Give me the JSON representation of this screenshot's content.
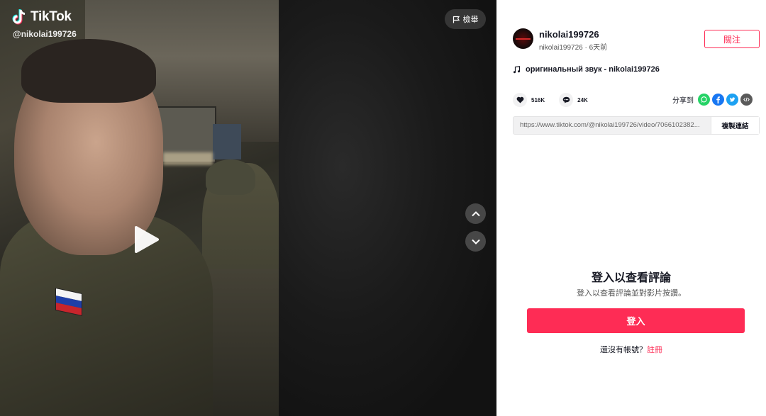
{
  "video": {
    "brand": "TikTok",
    "handle": "@nikolai199726",
    "report_label": "檢舉"
  },
  "author": {
    "username": "nikolai199726",
    "subline": "nikolai199726 · 6天前",
    "follow_label": "關注"
  },
  "music": {
    "title": "оригинальный звук - nikolai199726"
  },
  "stats": {
    "likes": "516K",
    "comments": "24K"
  },
  "share": {
    "label": "分享到"
  },
  "link": {
    "url": "https://www.tiktok.com/@nikolai199726/video/7066102382...",
    "copy_label": "複製連結"
  },
  "comments_login": {
    "title": "登入以查看評論",
    "subtitle": "登入以查看評論並對影片按讚。",
    "login_label": "登入",
    "signup_prompt": "還沒有帳號？",
    "signup_link": "註冊"
  },
  "colors": {
    "accent": "#fe2c55",
    "whatsapp": "#25d366",
    "facebook": "#1877f2",
    "twitter": "#1da1f2",
    "embed": "#5a5a5a"
  },
  "icons": [
    "tiktok-logo-icon",
    "flag-icon",
    "play-icon",
    "chevron-up-icon",
    "chevron-down-icon",
    "music-note-icon",
    "heart-icon",
    "comment-icon",
    "whatsapp-icon",
    "facebook-icon",
    "twitter-icon",
    "embed-icon"
  ]
}
